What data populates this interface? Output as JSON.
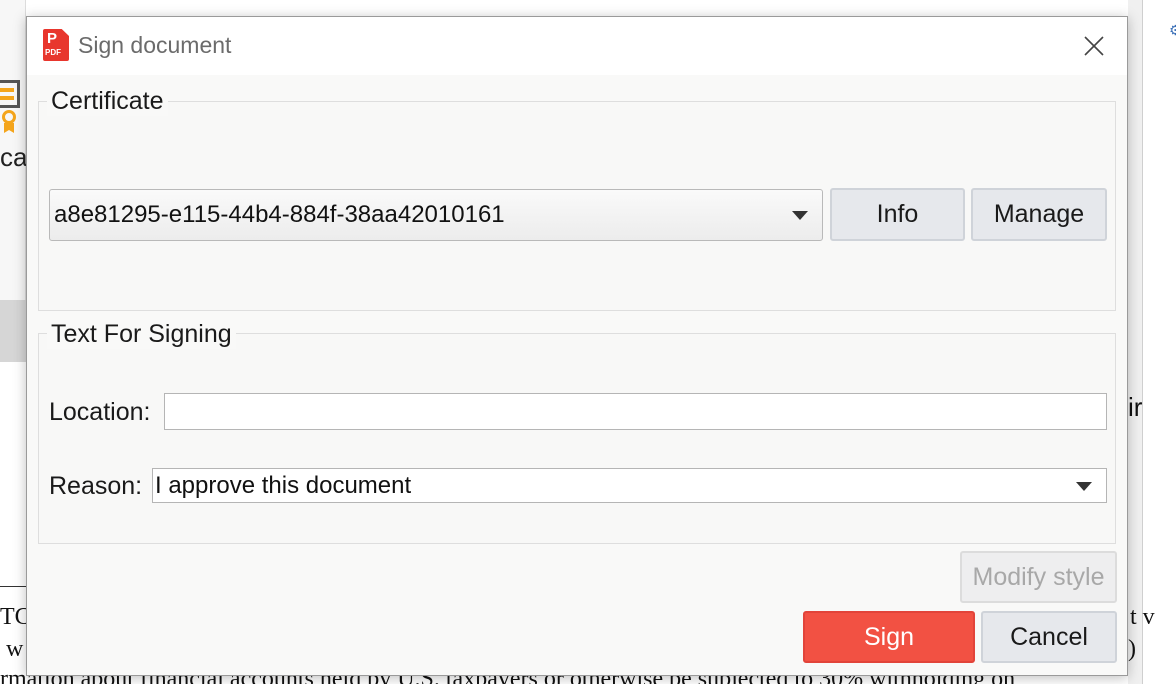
{
  "background": {
    "left_cut_text": "cat",
    "right_cut_text": "ir",
    "bottom_text_line1_left": "TC",
    "bottom_text_line1_right": "t v",
    "bottom_text_line2_left": "w",
    "bottom_text_line2_right": ")",
    "bottom_text_line3": "rmation about financial accounts held by U.S. taxpayers or otherwise be subjected to 30% withholding on"
  },
  "dialog": {
    "title": "Sign document",
    "app_icon_letter": "P",
    "app_icon_label": "PDF",
    "close_icon": "close-icon",
    "certificate": {
      "legend": "Certificate",
      "selected": "a8e81295-e115-44b4-884f-38aa42010161",
      "info_label": "Info",
      "manage_label": "Manage"
    },
    "text_for_signing": {
      "legend": "Text For Signing",
      "location_label": "Location:",
      "location_value": "",
      "location_placeholder": "",
      "reason_label": "Reason:",
      "reason_value": "I approve this document"
    },
    "buttons": {
      "modify_style": "Modify style",
      "sign": "Sign",
      "cancel": "Cancel"
    }
  },
  "colors": {
    "sign_button": "#f25143",
    "title_text": "#6b6b6b",
    "pdf_icon": "#e8362d"
  }
}
